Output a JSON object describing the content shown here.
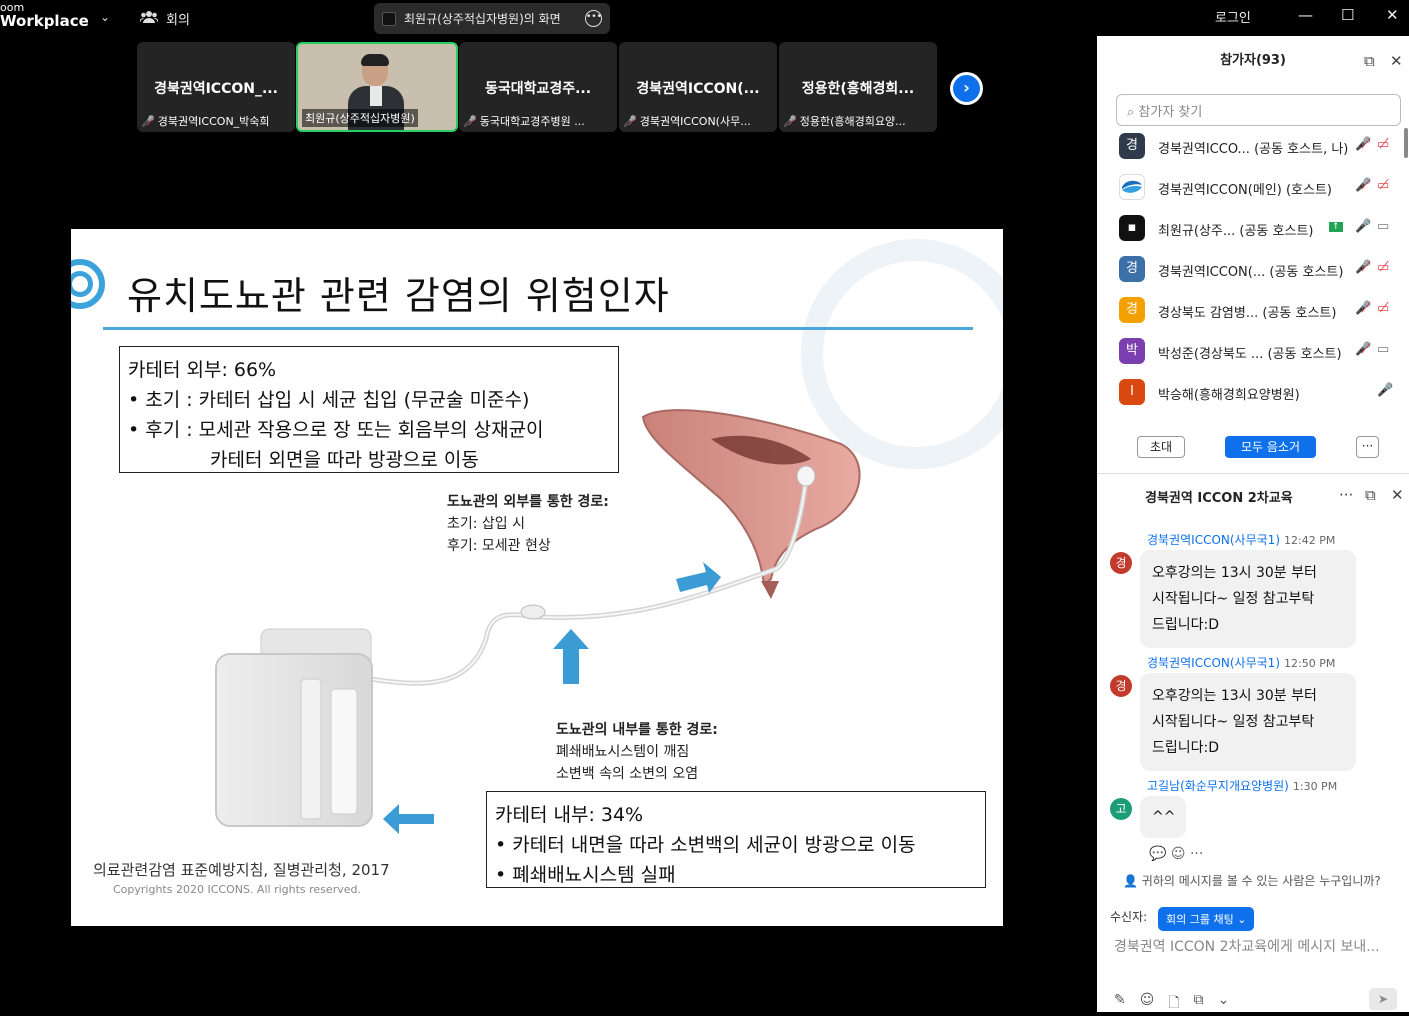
{
  "app": {
    "brand_line1": "oom",
    "brand_line2": "Workplace",
    "meeting_label": "회의",
    "login_label": "로그인"
  },
  "share_pill": {
    "label": "최원규(상주적십자병원)의 화면"
  },
  "thumbnails": [
    {
      "name": "경북권역ICCON_...",
      "label": "경북권역ICCON_박숙희"
    },
    {
      "name": "",
      "label": "최원규(상주적십자병원)"
    },
    {
      "name": "동국대학교경주...",
      "label": "동국대학교경주병원 ..."
    },
    {
      "name": "경북권역ICCON(...",
      "label": "경북권역ICCON(사무..."
    },
    {
      "name": "정용한(흥해경희...",
      "label": "정용한(흥해경희요양..."
    }
  ],
  "slide": {
    "title": "유치도뇨관 관련 감염의 위험인자",
    "box1": {
      "line1": "카테터 외부: 66%",
      "line2": "• 초기 : 카테터 삽입 시 세균 칩입 (무균술 미준수)",
      "line3": "• 후기 : 모세관 작용으로 장 또는 회음부의 상재균이",
      "line4": "카테터 외면을 따라 방광으로 이동"
    },
    "cap_outer": {
      "title": "도뇨관의 외부를 통한 경로:",
      "l1": "초기: 삽입 시",
      "l2": "후기: 모세관 현상"
    },
    "cap_inner": {
      "title": "도뇨관의 내부를 통한 경로:",
      "l1": "폐쇄배뇨시스템이 깨짐",
      "l2": "소변백 속의 소변의 오염"
    },
    "box2": {
      "line1": "카테터 내부: 34%",
      "line2": "• 카테터 내면을 따라 소변백의 세균이 방광으로 이동",
      "line3": "• 폐쇄배뇨시스템 실패"
    },
    "source": "의료관련감염 표준예방지침, 질병관리청, 2017",
    "copyright": "Copyrights 2020 ICCONS. All rights reserved."
  },
  "participants": {
    "title": "참가자(93)",
    "search_placeholder": "참가자 찾기",
    "list": [
      {
        "avatar": "경",
        "color": "#2f3b4c",
        "name": "경북권역ICCO... (공동 호스트, 나)"
      },
      {
        "avatar": "",
        "color": "#ffffff",
        "name": "경북권역ICCON(메인) (호스트)"
      },
      {
        "avatar": "",
        "color": "#111111",
        "name": "최원규(상주...   (공동 호스트)"
      },
      {
        "avatar": "경",
        "color": "#3d6fa8",
        "name": "경북권역ICCON(...  (공동 호스트)"
      },
      {
        "avatar": "경",
        "color": "#f2a100",
        "name": "경상북도 감염병...  (공동 호스트)"
      },
      {
        "avatar": "박",
        "color": "#7b3fb0",
        "name": "박성준(경상북도 ...  (공동 호스트)"
      },
      {
        "avatar": "I",
        "color": "#d9480f",
        "name": "박승해(흥해경희요양병원)"
      }
    ],
    "invite_label": "초대",
    "mute_all_label": "모두 음소거",
    "more_label": "···"
  },
  "chat": {
    "title": "경북권역 ICCON 2차교육",
    "messages": [
      {
        "sender": "경북권역ICCON(사무국1)",
        "time": "12:42 PM",
        "avatar": "경",
        "lines": [
          "오후강의는 13시 30분 부터",
          "시작됩니다~ 일정 참고부탁",
          "드립니다:D"
        ]
      },
      {
        "sender": "경북권역ICCON(사무국1)",
        "time": "12:50 PM",
        "avatar": "경",
        "lines": [
          "오후강의는 13시 30분 부터",
          "시작됩니다~ 일정 참고부탁",
          "드립니다:D"
        ]
      },
      {
        "sender": "고길남(화순무지개요양병원)",
        "time": "1:30 PM",
        "avatar": "고",
        "lines": [
          "^^"
        ]
      }
    ],
    "who_can_see": "귀하의 메시지를 볼 수 있는 사람은 누구입니까?",
    "recipient_label": "수신자:",
    "recipient_value": "회의 그룹 채팅",
    "input_placeholder": "경북권역 ICCON 2차교육에게 메시지 보내..."
  }
}
